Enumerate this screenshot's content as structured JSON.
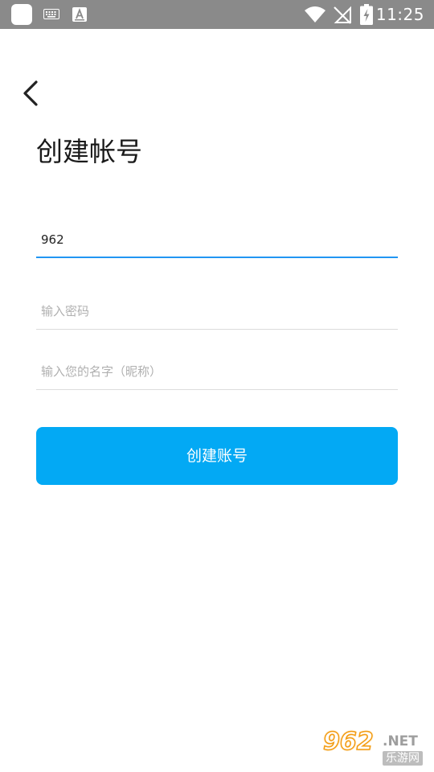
{
  "status_bar": {
    "time": "11:25",
    "icons": [
      "app-icon",
      "keyboard-icon",
      "a-icon",
      "wifi-icon",
      "signal-off-icon",
      "battery-charging-icon"
    ]
  },
  "nav": {
    "back_icon": "chevron-left-icon"
  },
  "page": {
    "title": "创建帐号"
  },
  "form": {
    "account": {
      "value": "962",
      "placeholder": ""
    },
    "password": {
      "value": "",
      "placeholder": "输入密码"
    },
    "nickname": {
      "value": "",
      "placeholder": "输入您的名字（昵称）"
    },
    "submit_label": "创建账号"
  },
  "watermark": {
    "number": "962",
    "net": ".NET",
    "cn": "乐游网"
  },
  "colors": {
    "status_bar": "#8a8a8a",
    "accent_underline": "#2196f3",
    "button": "#03a9f4",
    "divider": "#dcdcdc",
    "placeholder": "#b0b0b0"
  }
}
